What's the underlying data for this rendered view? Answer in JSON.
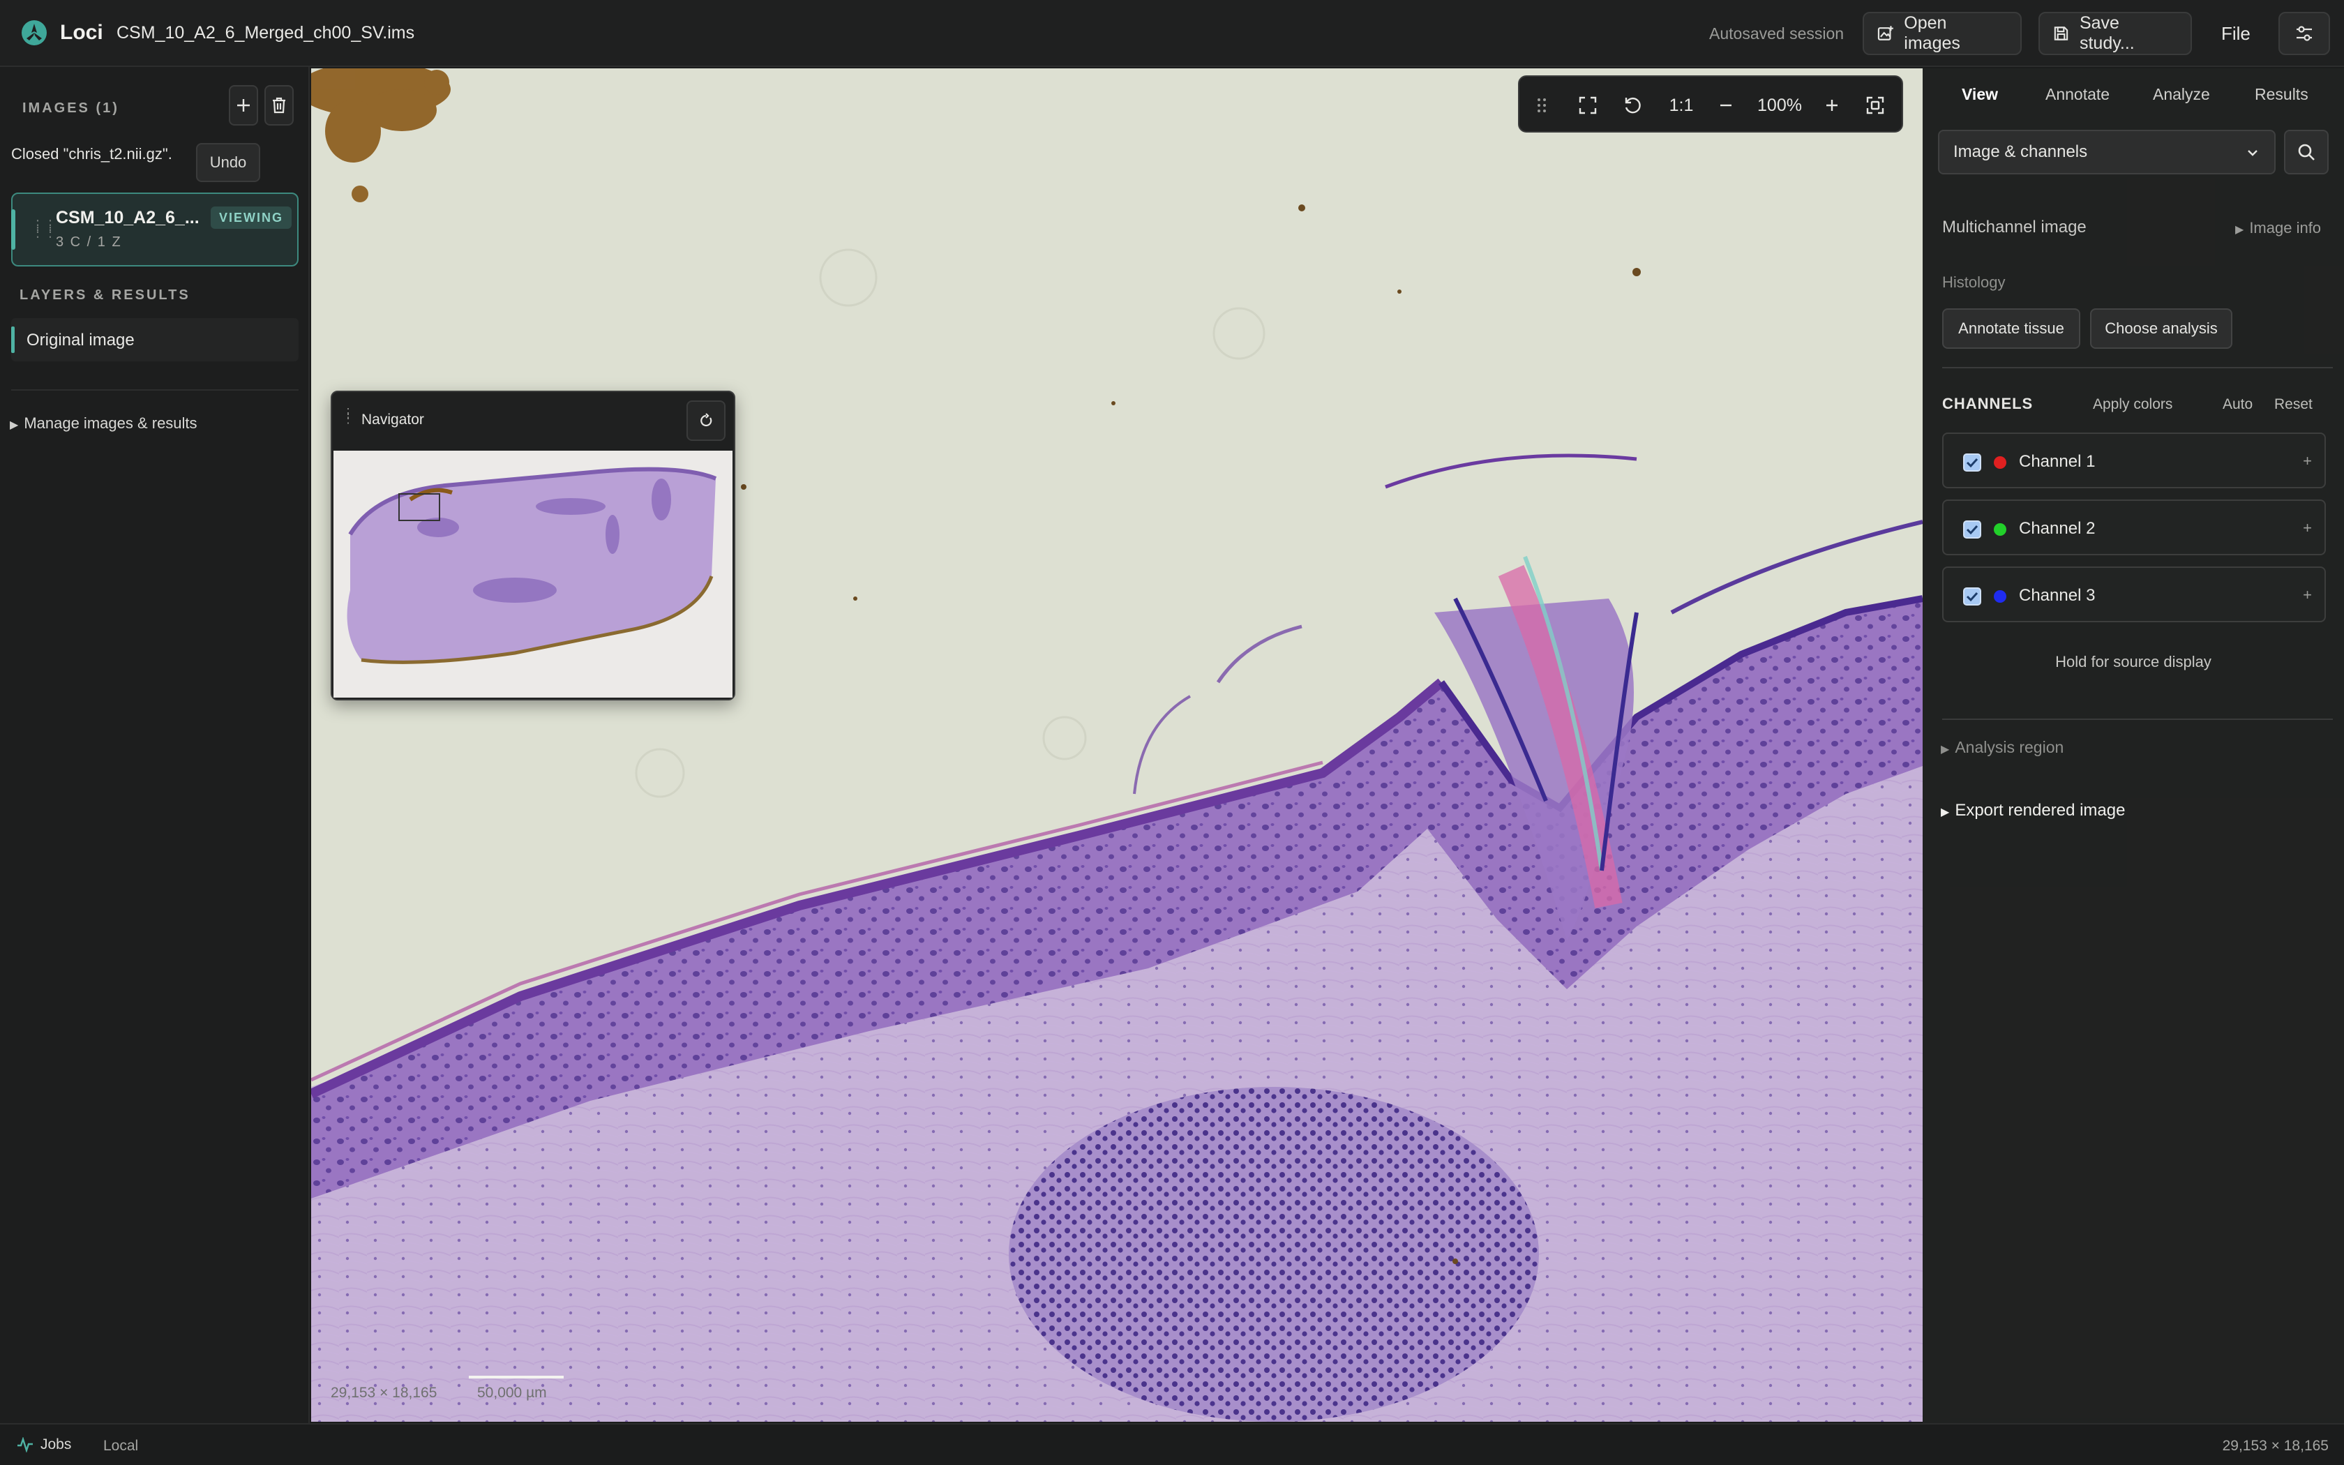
{
  "app": {
    "name": "Loci",
    "file_name": "CSM_10_A2_6_Merged_ch00_SV.ims",
    "autosave": "Autosaved session",
    "open_images": "Open images",
    "save_study": "Save study...",
    "file_menu": "File"
  },
  "sidebar": {
    "images_header": "IMAGES (1)",
    "toast_text": "Closed \"chris_t2.nii.gz\".",
    "undo_label": "Undo",
    "image_card": {
      "title": "CSM_10_A2_6_...",
      "subtitle": "3 C / 1 Z",
      "badge": "VIEWING"
    },
    "layers_header": "LAYERS & RESULTS",
    "layers": [
      {
        "label": "Original image"
      }
    ],
    "manage_label": "Manage images & results"
  },
  "viewer": {
    "toolbar": {
      "one_to_one": "1:1",
      "zoom": "100%"
    },
    "scale_dims": "29,153 × 18,165",
    "scale_label": "50,000 µm"
  },
  "navigator": {
    "title": "Navigator"
  },
  "right_panel": {
    "tabs": [
      {
        "label": "View",
        "active": true
      },
      {
        "label": "Annotate",
        "active": false
      },
      {
        "label": "Analyze",
        "active": false
      },
      {
        "label": "Results",
        "active": false
      }
    ],
    "dropdown_value": "Image & channels",
    "multichannel_label": "Multichannel image",
    "image_info": "Image info",
    "histology_label": "Histology",
    "annotate_tissue": "Annotate tissue",
    "choose_analysis": "Choose analysis",
    "channels_header": "CHANNELS",
    "apply_colors": "Apply colors",
    "auto": "Auto",
    "reset": "Reset",
    "channels": [
      {
        "name": "Channel 1",
        "color": "#e02020",
        "checked": true
      },
      {
        "name": "Channel 2",
        "color": "#22d02a",
        "checked": true
      },
      {
        "name": "Channel 3",
        "color": "#1f2cf0",
        "checked": true
      }
    ],
    "hold_text": "Hold for source display",
    "analysis_region": "Analysis region",
    "export_rendered": "Export rendered image"
  },
  "status_bar": {
    "jobs": "Jobs",
    "mode": "Local",
    "dims": "29,153 × 18,165"
  },
  "colors": {
    "accent": "#4fb3a4",
    "tissue_purple": "#7a4ea8",
    "background_canvas": "#dcdfd0"
  }
}
